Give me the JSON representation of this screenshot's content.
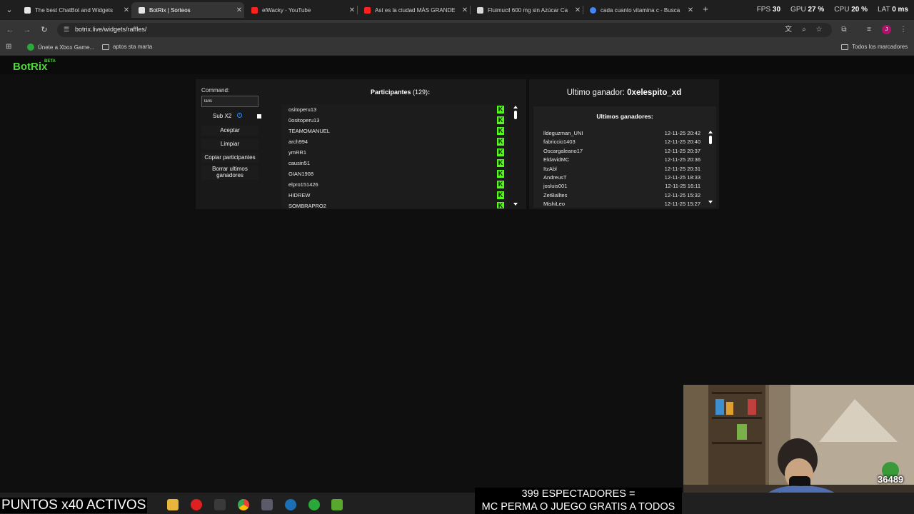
{
  "browser": {
    "tabs": [
      {
        "title": "The best ChatBot and Widgets",
        "favicon_color": "#e6e6e6",
        "active": false
      },
      {
        "title": "BotRix | Sorteos",
        "favicon_color": "#e6e6e6",
        "active": true
      },
      {
        "title": "elWacky - YouTube",
        "favicon_color": "#ff2020",
        "active": false
      },
      {
        "title": "Así es la ciudad MÁS GRANDE",
        "favicon_color": "#ff2020",
        "active": false
      },
      {
        "title": "Fluimucil 600 mg sin Azúcar Ca",
        "favicon_color": "#d8d8d8",
        "active": false
      },
      {
        "title": "cada cuanto vitamina c - Busca",
        "favicon_color": "#4285f4",
        "active": false
      }
    ],
    "new_tab_label": "+",
    "stats": {
      "fps_label": "FPS",
      "fps_value": "30",
      "gpu_label": "GPU",
      "gpu_value": "27 %",
      "cpu_label": "CPU",
      "cpu_value": "20 %",
      "lat_label": "LAT",
      "lat_value": "0 ms"
    },
    "url": "botrix.live/widgets/raffles/",
    "bookmarks": [
      {
        "label": "Únete a Xbox Game...",
        "icon": "xbox-icon"
      },
      {
        "label": "aptos sta marta",
        "icon": "folder-icon"
      }
    ],
    "all_bookmarks_label": "Todos los marcadores",
    "profile_initial": "J"
  },
  "site": {
    "logo": "BotRix",
    "logo_badge": "BETA",
    "accent": "#53fc18"
  },
  "raffle": {
    "command_label": "Command:",
    "command_value": "laris",
    "sub_x2_label": "Sub X2",
    "buttons": {
      "accept": "Aceptar",
      "clear": "Limpiar",
      "copy": "Copiar participantes",
      "delete_winners": "Borrar ultimos ganadores"
    },
    "participants_title": "Participantes",
    "participants_count": "(129)",
    "participants_colon": ":",
    "participants": [
      "ositoperu13",
      "0ositoperu13",
      "TEAMOMANUEL",
      "arch994",
      "ymRR1",
      "causin51",
      "GIAN1908",
      "elpro151426",
      "HIDREW",
      "SOMBRAPRO2"
    ],
    "kick_glyph": "K"
  },
  "winners": {
    "last_winner_label": "Ultimo ganador:",
    "last_winner_name": "0xelespito_xd",
    "list_title": "Ultimos ganadores:",
    "list": [
      {
        "name": "lldeguzman_UNI",
        "date": "12-11-25 20:42"
      },
      {
        "name": "fabriccio1403",
        "date": "12-11-25 20:40"
      },
      {
        "name": "Oscargaleano17",
        "date": "12-11-25 20:37"
      },
      {
        "name": "EldavidMC",
        "date": "12-11-25 20:36"
      },
      {
        "name": "ItzAbl",
        "date": "12-11-25 20:31"
      },
      {
        "name": "AndreusT",
        "date": "12-11-25 18:33"
      },
      {
        "name": "josluis001",
        "date": "12-11-25 16:11"
      },
      {
        "name": "ZetBalltes",
        "date": "12-11-25 15:32"
      },
      {
        "name": "MishiLeo",
        "date": "12-11-25 15:27"
      }
    ]
  },
  "stream": {
    "puntos_text": "PUNTOS x40 ACTIVOS",
    "viewer_badge": "36489",
    "banner_line1": "399 ESPECTADORES =",
    "banner_line2": "MC PERMA O JUEGO GRATIS A TODOS"
  }
}
